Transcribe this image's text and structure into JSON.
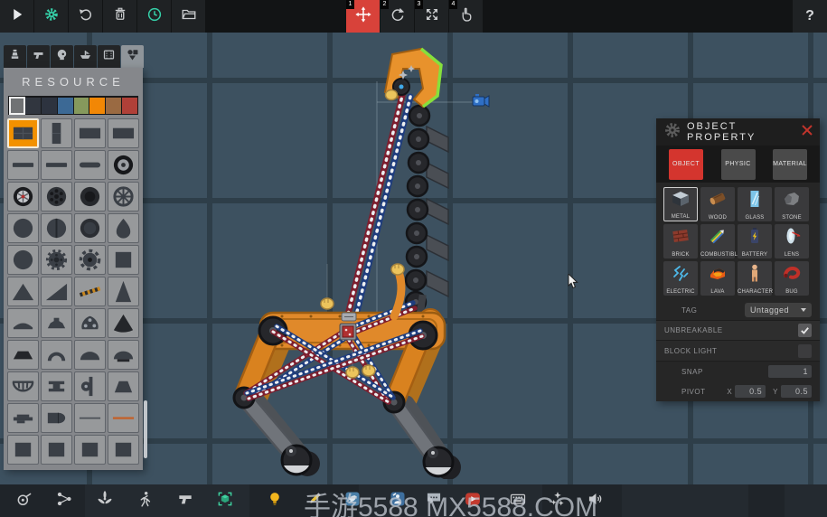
{
  "theme": {
    "accent_teal": "#35d0a8",
    "active_red": "#d8423a",
    "select_orange": "#f29100",
    "canvas_tile": "#3d5160",
    "grid_line": "#2e3e49",
    "panel_gray": "#85878b"
  },
  "watermark": {
    "text": "手游5588 MX5588.COM"
  },
  "topbar": {
    "file_tools": [
      {
        "name": "play",
        "icon": "play-icon"
      },
      {
        "name": "settings",
        "icon": "gear-icon"
      },
      {
        "name": "undo",
        "icon": "undo-icon"
      },
      {
        "name": "delete",
        "icon": "trash-icon"
      },
      {
        "name": "history",
        "icon": "clock-icon"
      },
      {
        "name": "load",
        "icon": "folder-icon"
      }
    ],
    "transform_tools": [
      {
        "name": "move",
        "hotkey": "1",
        "icon": "move-icon",
        "active": true
      },
      {
        "name": "rotate",
        "hotkey": "2",
        "icon": "rotate-icon",
        "active": false
      },
      {
        "name": "scale",
        "hotkey": "3",
        "icon": "scale-icon",
        "active": false
      },
      {
        "name": "drag",
        "hotkey": "4",
        "icon": "hand-icon",
        "active": false
      }
    ],
    "help_label": "?"
  },
  "resource_panel": {
    "title": "RESOURCE",
    "category_tabs": [
      {
        "name": "figures",
        "icon": "figure-icon",
        "active": false
      },
      {
        "name": "weapons",
        "icon": "gun-icon",
        "active": false
      },
      {
        "name": "heads",
        "icon": "head-icon",
        "active": false
      },
      {
        "name": "vehicles",
        "icon": "vehicle-icon",
        "active": false
      },
      {
        "name": "clips",
        "icon": "film-icon",
        "active": false
      },
      {
        "name": "parts",
        "icon": "parts-icon",
        "active": true
      }
    ],
    "palette": {
      "selected_index": 0,
      "colors": [
        "#707274",
        "#31363f",
        "#2d333f",
        "#3c6995",
        "#86995c",
        "#f28705",
        "#9a6a42",
        "#b04038"
      ]
    },
    "items": [
      {
        "part": "metal-box",
        "selected": true
      },
      {
        "part": "tall-box",
        "selected": false
      },
      {
        "part": "plate",
        "selected": false
      },
      {
        "part": "plate",
        "selected": false
      },
      {
        "part": "plank",
        "selected": false
      },
      {
        "part": "plank",
        "selected": false
      },
      {
        "part": "pill-plank",
        "selected": false
      },
      {
        "part": "tire",
        "selected": false
      },
      {
        "part": "alloy-wheel",
        "selected": false
      },
      {
        "part": "holed-wheel",
        "selected": false
      },
      {
        "part": "dark-wheel",
        "selected": false
      },
      {
        "part": "wagon-wheel",
        "selected": false
      },
      {
        "part": "circle",
        "selected": false
      },
      {
        "part": "split-circle",
        "selected": false
      },
      {
        "part": "dark-circle",
        "selected": false
      },
      {
        "part": "teardrop",
        "selected": false
      },
      {
        "part": "circle",
        "selected": false
      },
      {
        "part": "gear-wheel",
        "selected": false
      },
      {
        "part": "saw-blade",
        "selected": false
      },
      {
        "part": "square",
        "selected": false
      },
      {
        "part": "triangle",
        "selected": false
      },
      {
        "part": "right-triangle",
        "selected": false
      },
      {
        "part": "hazard-ramp",
        "selected": false
      },
      {
        "part": "tall-triangle",
        "selected": false
      },
      {
        "part": "low-dome",
        "selected": false
      },
      {
        "part": "ridge-dome",
        "selected": false
      },
      {
        "part": "bolt-plate",
        "selected": false
      },
      {
        "part": "round-triangle",
        "selected": false
      },
      {
        "part": "trapezoid",
        "selected": false
      },
      {
        "part": "arch",
        "selected": false
      },
      {
        "part": "half-dome",
        "selected": false
      },
      {
        "part": "cap-dome",
        "selected": false
      },
      {
        "part": "grill-dome",
        "selected": false
      },
      {
        "part": "i-beam",
        "selected": false
      },
      {
        "part": "key-plate",
        "selected": false
      },
      {
        "part": "wedge",
        "selected": false
      },
      {
        "part": "step-plate",
        "selected": false
      },
      {
        "part": "bullet",
        "selected": false
      },
      {
        "part": "thin-rod",
        "selected": false
      },
      {
        "part": "orange-rod",
        "selected": false
      },
      {
        "part": "box",
        "selected": false
      },
      {
        "part": "box",
        "selected": false
      },
      {
        "part": "box",
        "selected": false
      },
      {
        "part": "box",
        "selected": false
      }
    ]
  },
  "property_panel": {
    "title": "OBJECT PROPERTY",
    "tabs": [
      {
        "label": "OBJECT",
        "active": true
      },
      {
        "label": "PHYSIC",
        "active": false
      },
      {
        "label": "MATERIAL",
        "active": false
      }
    ],
    "materials": [
      {
        "label": "METAL",
        "icon": "metal-icon",
        "selected": true
      },
      {
        "label": "WOOD",
        "icon": "wood-icon",
        "selected": false
      },
      {
        "label": "GLASS",
        "icon": "glass-icon",
        "selected": false
      },
      {
        "label": "STONE",
        "icon": "stone-icon",
        "selected": false
      },
      {
        "label": "BRICK",
        "icon": "brick-icon",
        "selected": false
      },
      {
        "label": "COMBUSTIBLE",
        "icon": "combustible-icon",
        "selected": false
      },
      {
        "label": "BATTERY",
        "icon": "battery-icon",
        "selected": false
      },
      {
        "label": "LENS",
        "icon": "lens-icon",
        "selected": false
      },
      {
        "label": "ELECTRIC",
        "icon": "electric-icon",
        "selected": false
      },
      {
        "label": "LAVA",
        "icon": "lava-icon",
        "selected": false
      },
      {
        "label": "CHARACTER",
        "icon": "character-icon",
        "selected": false
      },
      {
        "label": "BUG",
        "icon": "bug-icon",
        "selected": false
      }
    ],
    "tag": {
      "label": "TAG",
      "value": "Untagged"
    },
    "unbreakable": {
      "label": "UNBREAKABLE",
      "checked": true
    },
    "block_light": {
      "label": "BLOCK LIGHT",
      "checked": false
    },
    "snap": {
      "label": "SNAP",
      "value": "1"
    },
    "pivot": {
      "label": "PIVOT",
      "x_label": "X",
      "x": "0.5",
      "y_label": "Y",
      "y": "0.5"
    }
  },
  "bottombar": {
    "tools": [
      {
        "name": "mechanism",
        "icon": "cam-icon",
        "active": false
      },
      {
        "name": "node-graph",
        "icon": "nodes-icon",
        "active": false
      },
      {
        "name": "propeller",
        "icon": "propeller-icon",
        "active": false
      },
      {
        "name": "character-test",
        "icon": "runner-icon",
        "active": false
      },
      {
        "name": "weapon",
        "icon": "pistol-icon",
        "active": false
      },
      {
        "name": "select-object",
        "icon": "cube-select-icon",
        "active": true
      },
      {
        "name": "light",
        "icon": "bulb-icon",
        "active": false
      },
      {
        "name": "paint",
        "icon": "pencil-icon",
        "active": false
      },
      {
        "name": "social",
        "icon": "bird-icon",
        "active": false
      },
      {
        "name": "workshop",
        "icon": "builder-icon",
        "active": false
      },
      {
        "name": "chat",
        "icon": "chat-icon",
        "active": false
      },
      {
        "name": "videos",
        "icon": "video-icon",
        "active": false
      },
      {
        "name": "controls",
        "icon": "keyboard-icon",
        "active": false
      },
      {
        "name": "effects",
        "icon": "sparkles-icon",
        "active": false
      },
      {
        "name": "sound",
        "icon": "speaker-icon",
        "active": false
      }
    ]
  }
}
